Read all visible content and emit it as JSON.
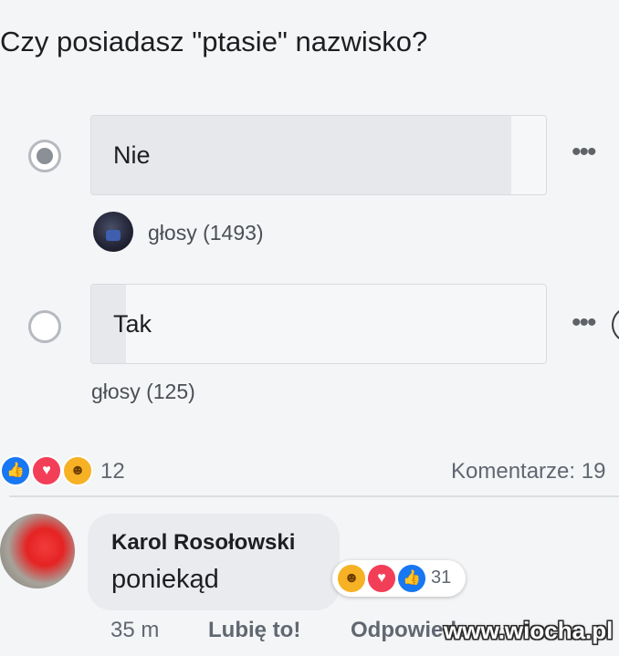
{
  "poll": {
    "question": "Czy posiadasz \"ptasie\" nazwisko?",
    "options": [
      {
        "label": "Nie",
        "selected": true,
        "votes_text": "głosy (1493)",
        "share": 0.923,
        "more_icon": "ellipsis-icon"
      },
      {
        "label": "Tak",
        "selected": false,
        "votes_text": "głosy (125)",
        "share": 0.077,
        "more_icon": "ellipsis-icon"
      }
    ]
  },
  "post_reactions": {
    "icons": [
      "like-icon",
      "love-icon",
      "haha-icon"
    ],
    "count": "12",
    "comments": "Komentarze: 19"
  },
  "comment": {
    "author": "Karol Rosołowski",
    "text": "poniekąd",
    "reactions": {
      "icons": [
        "haha-icon",
        "love-icon",
        "like-icon"
      ],
      "count": "31"
    },
    "actions": {
      "time": "35 m",
      "like": "Lubię to!",
      "reply": "Odpowiedz"
    }
  },
  "watermark": "www.wiocha.pl",
  "colors": {
    "like": "#1877f2",
    "love": "#f33e58",
    "haha": "#f7b125",
    "poll_fill": "#e7e8eb"
  }
}
